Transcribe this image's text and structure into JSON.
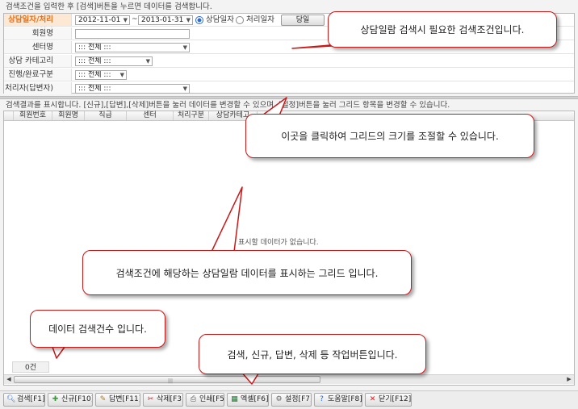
{
  "search": {
    "description": "검색조건을 입력한 후 [검색]버튼을 누르면 데이터를 검색합니다.",
    "date_label": "상담일자/처리일자",
    "date_from": "2012-11-01",
    "date_sep": "~",
    "date_to": "2013-01-31",
    "radio_consult": "상담일자",
    "radio_process": "처리일자",
    "today_button": "당일",
    "member_label": "회원명",
    "member_value": "",
    "center_label": "센터명",
    "center_value": "::: 전체 :::",
    "category_label": "상담 카테고리",
    "category_value": "::: 전체 :::",
    "status_label": "진행/완료구분",
    "status_value": "::: 전체 :::",
    "handler_label": "처리자(답변자)",
    "handler_value": "::: 전체 :::"
  },
  "result": {
    "description": "검색결과를 표시합니다. [신규],[답변],[삭제]버튼을 눌러 데이터를 변경할 수 있으며, [설정]버튼을 눌러 그리드 항목을 변경할 수 있습니다.",
    "columns": [
      "회원번호",
      "회원명",
      "직급",
      "센터",
      "처리구분",
      "상담카테고"
    ],
    "empty_message": "표시할 데이터가 없습니다.",
    "count": "0건"
  },
  "toolbar": {
    "search": "검색[F1]",
    "new": "신규[F10]",
    "reply": "답변[F11]",
    "delete": "삭제[F3]",
    "print": "인쇄[F5]",
    "excel": "엑셀[F6]",
    "settings": "설정[F7]",
    "help": "도움말[F8]",
    "close": "닫기[F12]"
  },
  "callouts": {
    "search_conditions": "상담일람 검색시 필요한 검색조건입니다.",
    "resize": "이곳을 클릭하여 그리드의 크기를 조절할 수 있습니다.",
    "grid": "검색조건에 해당하는 상담일람 데이터를 표시하는 그리드 입니다.",
    "count": "데이터 검색건수 입니다.",
    "buttons": "검색, 신규, 답변, 삭제 등 작업버튼입니다."
  },
  "colors": {
    "accent": "#e0721e",
    "callout_border": "#c81919",
    "radio_selected": "#2a6bd6"
  }
}
